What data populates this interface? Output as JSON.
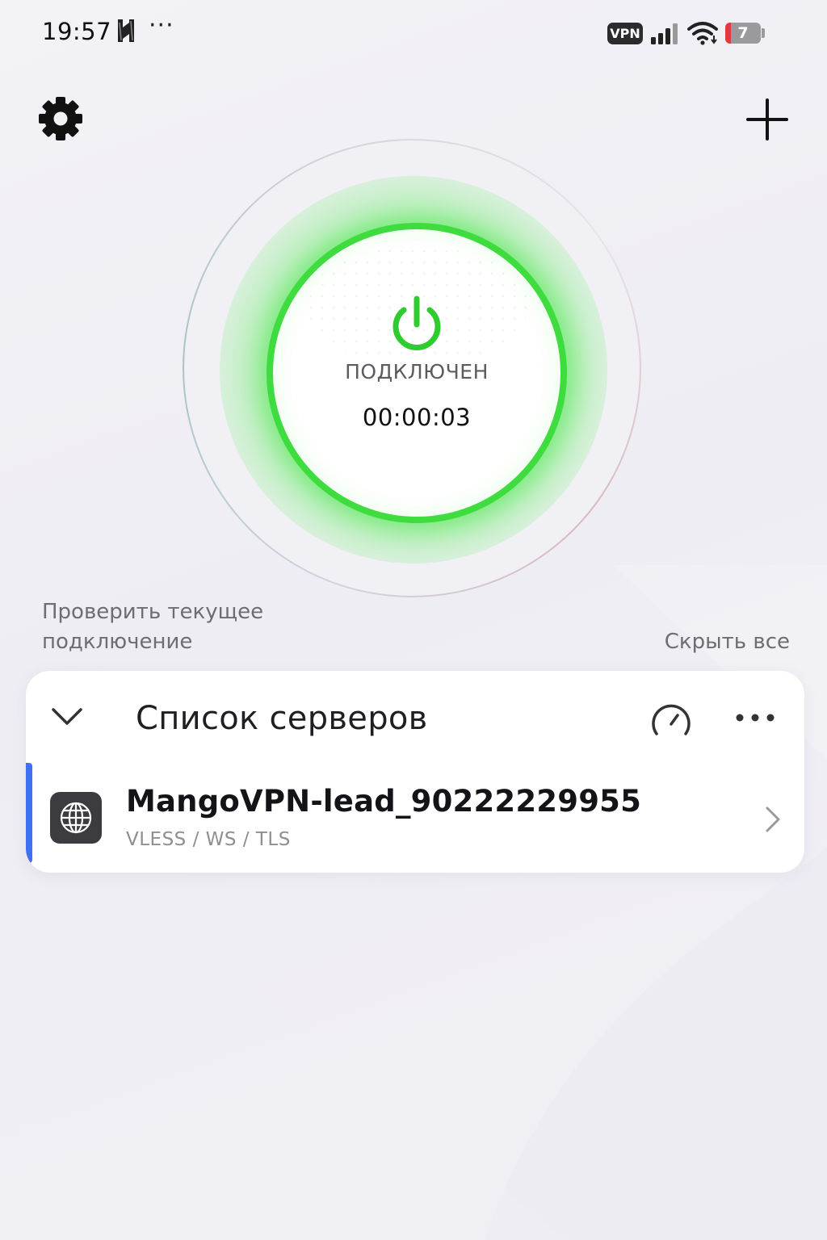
{
  "status_bar": {
    "time": "19:57",
    "dots": "···",
    "vpn_badge": "VPN",
    "battery_level": "7",
    "icons": [
      "notification-icon",
      "signal-icon",
      "wifi-icon",
      "battery-icon"
    ]
  },
  "toolbar": {
    "settings_icon": "gear-icon",
    "add_icon": "plus-icon"
  },
  "connection": {
    "status": "ПОДКЛЮЧЕН",
    "timer": "00:00:03",
    "icon": "power-icon",
    "accent_color": "#3fdc3f"
  },
  "links": {
    "check_connection": "Проверить текущее подключение",
    "hide_all": "Скрыть все"
  },
  "server_list": {
    "title": "Список серверов",
    "servers": [
      {
        "name": "MangoVPN-lead_90222229955",
        "protocol": "VLESS / WS / TLS",
        "icon": "globe-icon",
        "selected": true
      }
    ],
    "selected_color": "#3f6ff2"
  }
}
